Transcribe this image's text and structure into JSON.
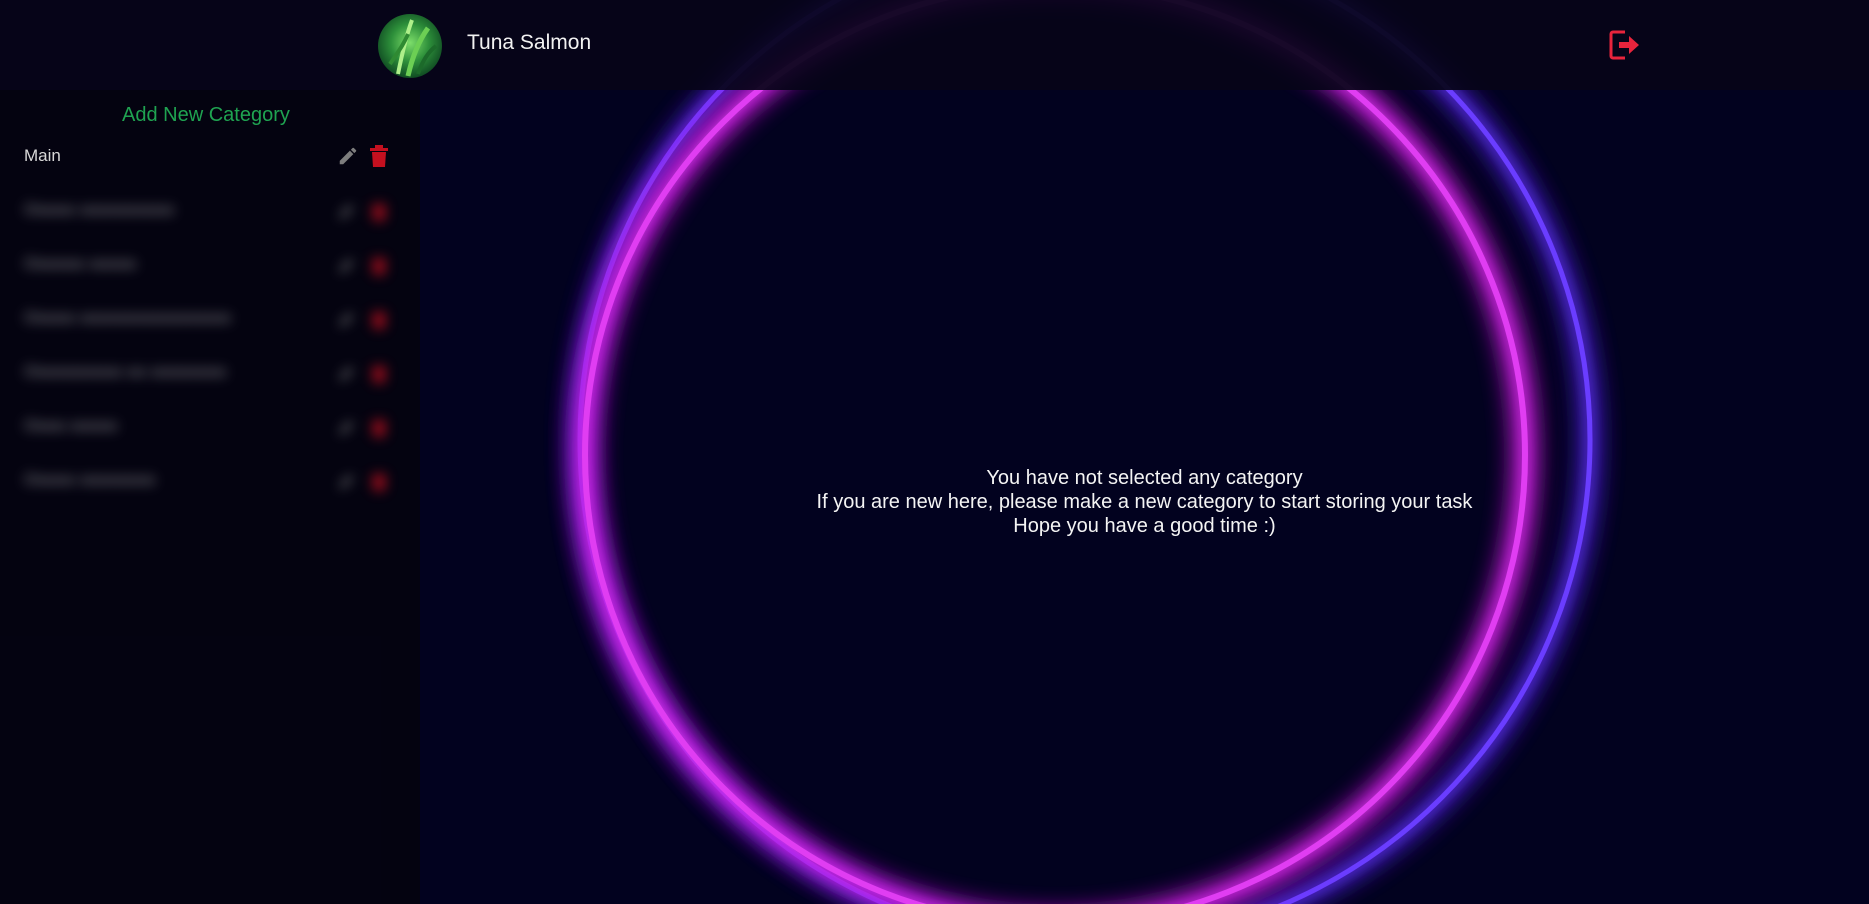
{
  "header": {
    "username": "Tuna Salmon",
    "avatar_icon": "avatar-photo",
    "logout_icon": "logout-icon",
    "logout_color": "#e8243c"
  },
  "sidebar": {
    "add_category_label": "Add New Category",
    "add_category_color": "#1fa351",
    "categories": [
      {
        "label": "Main",
        "blurred": false
      },
      {
        "label": "Ooooo oooooooooo",
        "blurred": true
      },
      {
        "label": "Oooooo ooooo",
        "blurred": true
      },
      {
        "label": "Ooooo oooooooooooooooo",
        "blurred": true
      },
      {
        "label": "Oooooooooo oo oooooooo",
        "blurred": true
      },
      {
        "label": "Oooo ooooo",
        "blurred": true
      },
      {
        "label": "Ooooo oooooooo",
        "blurred": true
      }
    ],
    "edit_icon": "pencil-icon",
    "delete_icon": "trash-icon",
    "delete_color": "#c4101f"
  },
  "main": {
    "empty_line_1": "You have not selected any category",
    "empty_line_2": "If you are new here, please make a new category to start storing your task",
    "empty_line_3": "Hope you have a good time :)"
  }
}
